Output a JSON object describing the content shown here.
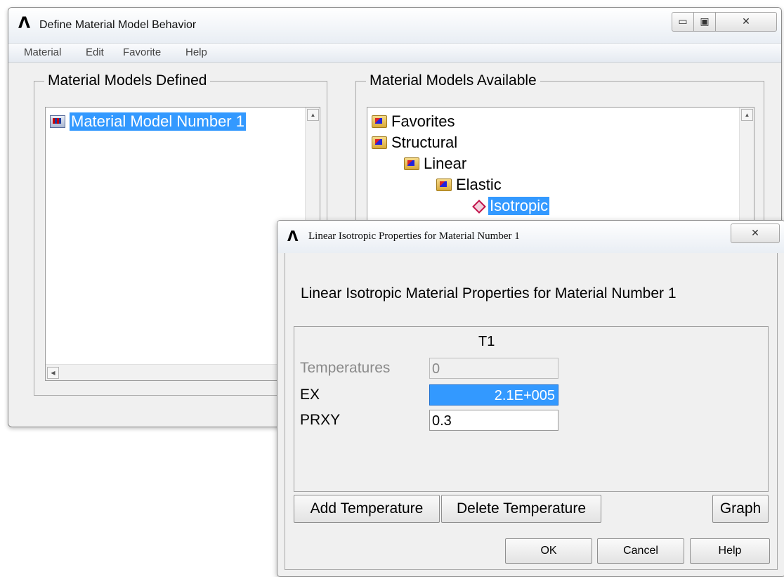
{
  "main_window": {
    "title": "Define Material Model Behavior",
    "menu": [
      "Material",
      "Edit",
      "Favorite",
      "Help"
    ],
    "controls": {
      "minimize": "▭",
      "maximize": "▣",
      "close": "✕"
    }
  },
  "defined_panel": {
    "label": "Material Models Defined",
    "items": [
      {
        "label": "Material Model Number 1",
        "selected": true
      }
    ]
  },
  "available_panel": {
    "label": "Material Models Available",
    "tree": [
      {
        "label": "Favorites",
        "level": 0
      },
      {
        "label": "Structural",
        "level": 0
      },
      {
        "label": "Linear",
        "level": 1
      },
      {
        "label": "Elastic",
        "level": 2
      },
      {
        "label": "Isotropic",
        "level": 3,
        "selected": true
      }
    ]
  },
  "dialog": {
    "title": "Linear Isotropic Properties for Material Number 1",
    "close": "✕",
    "heading": "Linear Isotropic Material Properties for Material Number 1",
    "column_header": "T1",
    "rows": [
      {
        "label": "Temperatures",
        "value": "0",
        "disabled": true
      },
      {
        "label": "EX",
        "value": "2.1E+005",
        "selected": true
      },
      {
        "label": "PRXY",
        "value": "0.3"
      }
    ],
    "buttons": {
      "add_temperature": "Add Temperature",
      "delete_temperature": "Delete Temperature",
      "graph": "Graph",
      "ok": "OK",
      "cancel": "Cancel",
      "help": "Help"
    }
  },
  "icons": {
    "app_logo": "ansys-logo-icon",
    "folder": "folder-icon",
    "material": "material-icon",
    "leaf": "diamond-material-icon"
  },
  "colors": {
    "selection": "#3399ff",
    "window_bg": "#f0f0f0"
  }
}
